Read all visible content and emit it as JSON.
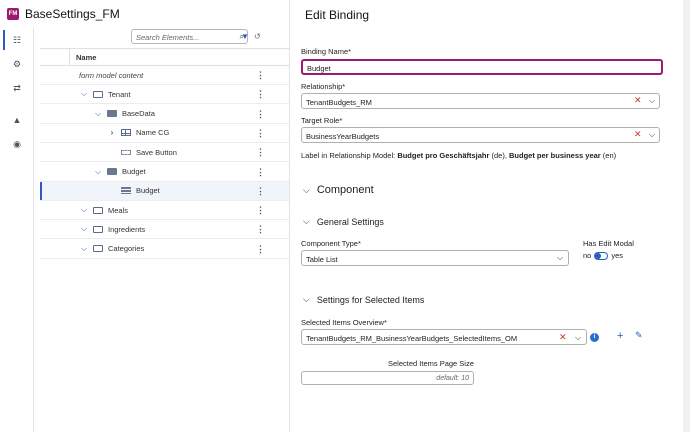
{
  "app": {
    "logo_text": "FM",
    "title": "BaseSettings_FM",
    "brand_color": "#9c1a6f",
    "accent_color": "#2b5bbf"
  },
  "rail": {
    "icons": [
      "hierarchy-icon",
      "gear-icon",
      "swap-icon",
      "shapes-icon",
      "eye-icon"
    ]
  },
  "tree": {
    "search_placeholder": "Search Elements...",
    "column_name": "Name",
    "rows": [
      {
        "label": "form model content",
        "icon": "none",
        "expanded": null
      },
      {
        "label": "Tenant",
        "icon": "container-icon",
        "expanded": true
      },
      {
        "label": "BaseData",
        "icon": "database-icon",
        "expanded": true
      },
      {
        "label": "Name CG",
        "icon": "grid-icon",
        "expanded": false
      },
      {
        "label": "Save Button",
        "icon": "button-icon",
        "expanded": null
      },
      {
        "label": "Budget",
        "icon": "database-icon",
        "expanded": true
      },
      {
        "label": "Budget",
        "icon": "table-list-icon",
        "expanded": null,
        "selected": true
      },
      {
        "label": "Meals",
        "icon": "container-icon",
        "expanded": true
      },
      {
        "label": "Ingredients",
        "icon": "container-icon",
        "expanded": true
      },
      {
        "label": "Categories",
        "icon": "container-icon",
        "expanded": true
      }
    ]
  },
  "binding": {
    "title": "Edit Binding",
    "name_label": "Binding Name*",
    "name_value": "Budget",
    "relationship_label": "Relationship*",
    "relationship_value": "TenantBudgets_RM",
    "target_role_label": "Target Role*",
    "target_role_value": "BusinessYearBudgets",
    "info_prefix": "Label in Relationship Model: ",
    "info_de": "Budget pro Geschäftsjahr",
    "info_de_suffix": " (de), ",
    "info_en": "Budget per business year",
    "info_en_suffix": " (en)"
  },
  "component": {
    "section_title": "Component",
    "general_title": "General Settings",
    "type_label": "Component Type*",
    "type_value": "Table List",
    "edit_modal_label": "Has Edit Modal",
    "toggle_no": "no",
    "toggle_yes": "yes",
    "toggle_value": false,
    "selected_title": "Settings for Selected Items",
    "overview_label": "Selected Items Overview*",
    "overview_value": "TenantBudgets_RM_BusinessYearBudgets_SelectedItems_OM",
    "page_size_label": "Selected Items Page Size",
    "page_size_placeholder": "default: 10"
  }
}
